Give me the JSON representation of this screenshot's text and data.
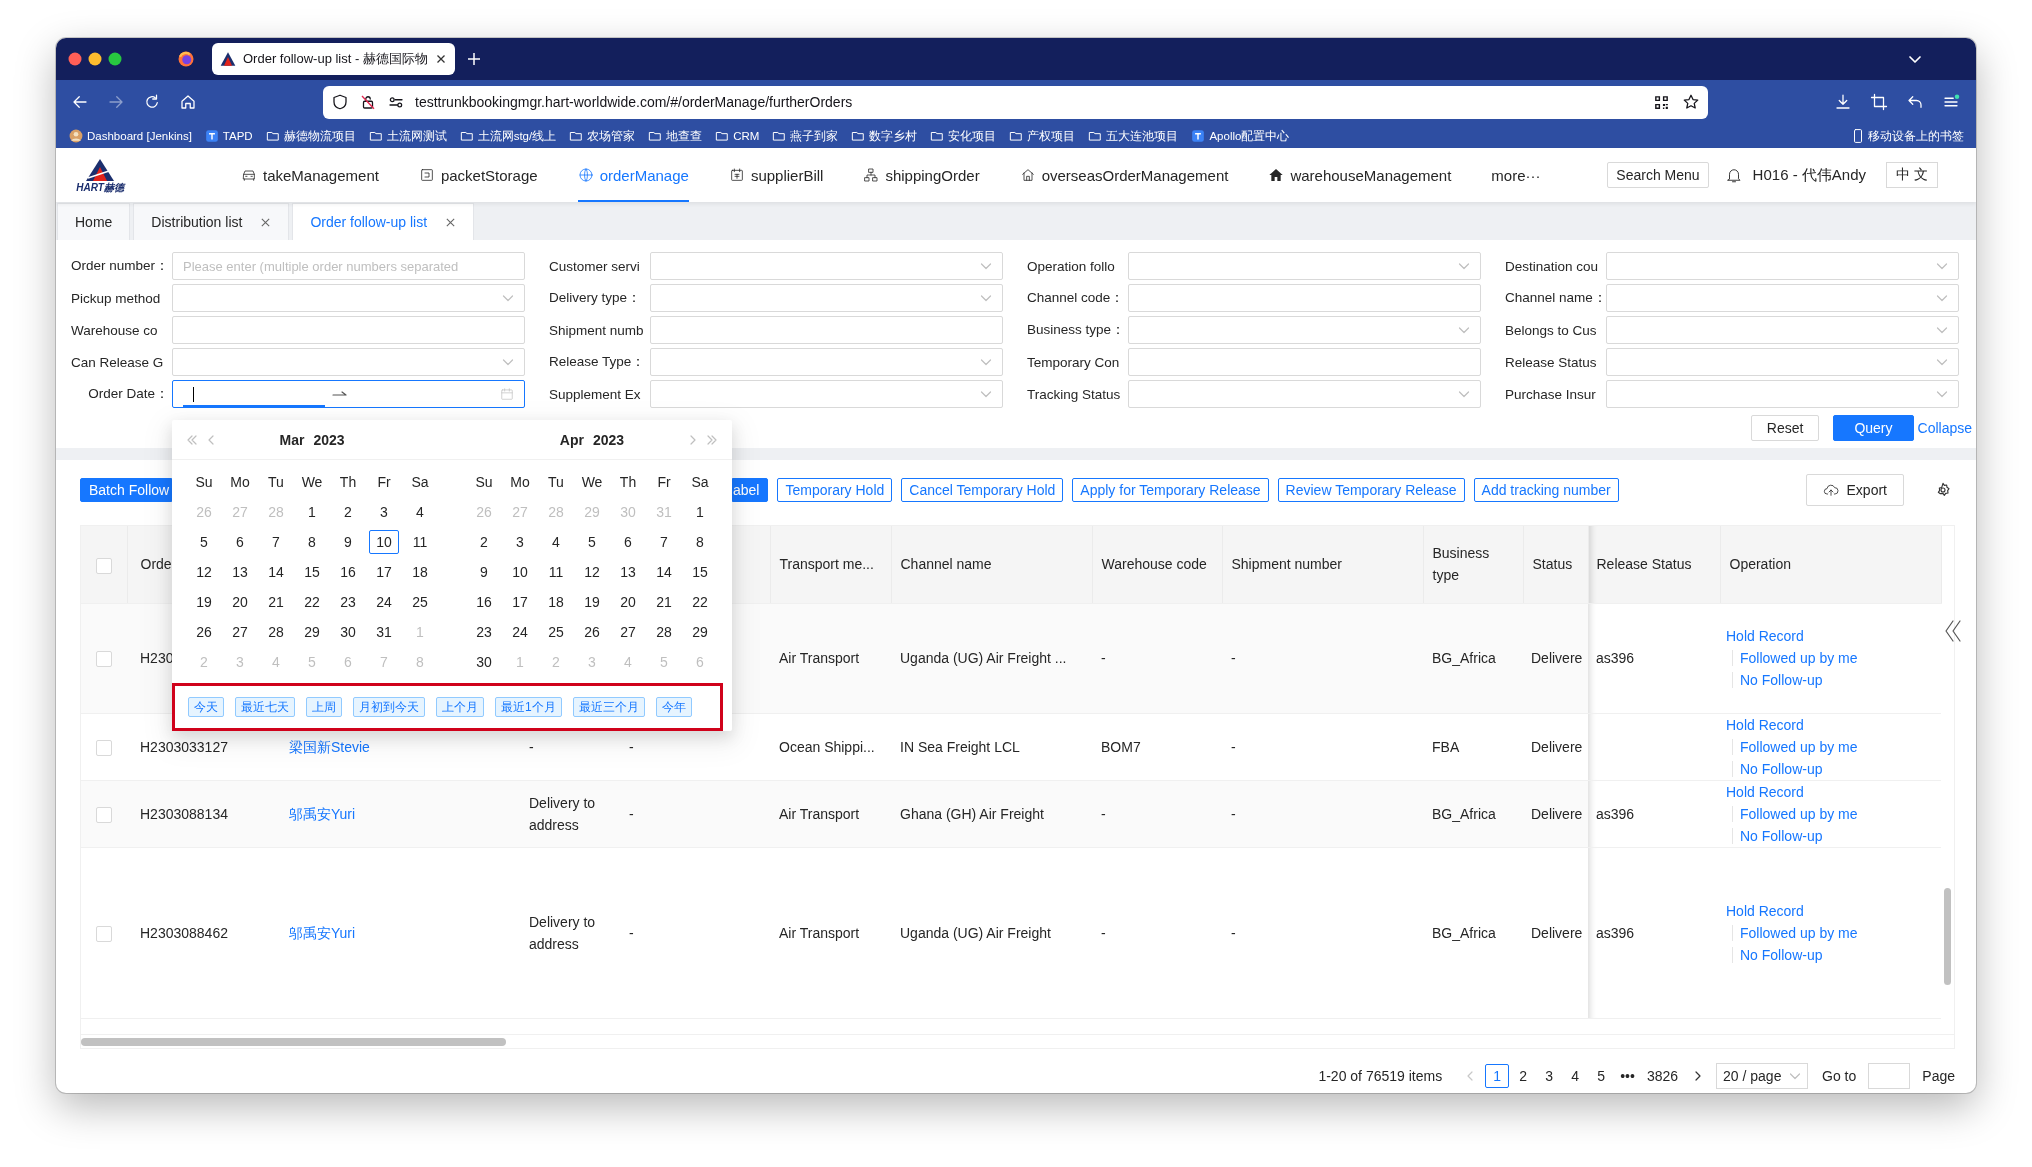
{
  "browser": {
    "tabs": [
      {
        "title": "Order follow-up list - 赫德国际物",
        "selected": true
      }
    ],
    "url": "testtrunkbookingmgr.hart-worldwide.com/#/orderManage/furtherOrders",
    "bookmarks": [
      {
        "label": "Dashboard [Jenkins]",
        "kind": "avatar"
      },
      {
        "label": "TAPD",
        "kind": "site"
      },
      {
        "label": "赫德物流项目",
        "kind": "folder"
      },
      {
        "label": "土流网测试",
        "kind": "folder"
      },
      {
        "label": "土流网stg/线上",
        "kind": "folder"
      },
      {
        "label": "农场管家",
        "kind": "folder"
      },
      {
        "label": "地查查",
        "kind": "folder"
      },
      {
        "label": "CRM",
        "kind": "folder"
      },
      {
        "label": "燕子到家",
        "kind": "folder"
      },
      {
        "label": "数字乡村",
        "kind": "folder"
      },
      {
        "label": "安化项目",
        "kind": "folder"
      },
      {
        "label": "产权项目",
        "kind": "folder"
      },
      {
        "label": "五大连池项目",
        "kind": "folder"
      },
      {
        "label": "Apollo配置中心",
        "kind": "site"
      }
    ],
    "mobile_bookmarks": "移动设备上的书签"
  },
  "app": {
    "logo_text": "HART赫德",
    "nav": [
      {
        "label": "takeManagement",
        "selected": false
      },
      {
        "label": "packetStorage",
        "selected": false
      },
      {
        "label": "orderManage",
        "selected": true
      },
      {
        "label": "supplierBill",
        "selected": false
      },
      {
        "label": "shippingOrder",
        "selected": false
      },
      {
        "label": "overseasOrderManagement",
        "selected": false
      },
      {
        "label": "warehouseManagement",
        "selected": false
      }
    ],
    "more": "more···",
    "search_button": "Search Menu",
    "user": "H016 - 代伟Andy",
    "language": "中 文"
  },
  "page_tabs": [
    {
      "label": "Home",
      "selected": false,
      "closable": false
    },
    {
      "label": "Distribution list",
      "selected": false,
      "closable": true
    },
    {
      "label": "Order follow-up list",
      "selected": true,
      "closable": true
    }
  ],
  "filters": [
    {
      "label": "Order number：",
      "kind": "text",
      "placeholder": "Please enter (multiple order numbers separated",
      "focused": false
    },
    {
      "label": "Customer servi",
      "kind": "select",
      "focused": false
    },
    {
      "label": "Operation follo",
      "kind": "select",
      "focused": false
    },
    {
      "label": "Destination cou",
      "kind": "select",
      "focused": false
    },
    {
      "label": "Pickup method",
      "kind": "select",
      "focused": false
    },
    {
      "label": "Delivery type：",
      "kind": "select",
      "focused": false
    },
    {
      "label": "Channel code：",
      "kind": "text",
      "focused": false
    },
    {
      "label": "Channel name：",
      "kind": "select",
      "focused": false
    },
    {
      "label": "Warehouse co",
      "kind": "text",
      "focused": false
    },
    {
      "label": "Shipment numb",
      "kind": "text",
      "focused": false
    },
    {
      "label": "Business type：",
      "kind": "select",
      "focused": false
    },
    {
      "label": "Belongs to Cus",
      "kind": "select",
      "focused": false
    },
    {
      "label": "Can Release G",
      "kind": "select",
      "focused": false
    },
    {
      "label": "Release Type：",
      "kind": "select",
      "focused": false
    },
    {
      "label": "Temporary Con",
      "kind": "text",
      "focused": false
    },
    {
      "label": "Release Status",
      "kind": "select",
      "focused": false
    },
    {
      "label": "Order Date：",
      "kind": "date_range",
      "focused": true
    },
    {
      "label": "Supplement Ex",
      "kind": "select",
      "focused": false
    },
    {
      "label": "Tracking Status",
      "kind": "select",
      "focused": false
    },
    {
      "label": "Purchase Insur",
      "kind": "select",
      "focused": false
    }
  ],
  "filter_actions": {
    "reset": "Reset",
    "query": "Query",
    "collapse": "Collapse"
  },
  "date_picker": {
    "months": [
      {
        "month": "Mar",
        "year": "2023",
        "weekdays": [
          "Su",
          "Mo",
          "Tu",
          "We",
          "Th",
          "Fr",
          "Sa"
        ],
        "weeks": [
          [
            {
              "day": "26",
              "in_month": false,
              "today": false
            },
            {
              "day": "27",
              "in_month": false,
              "today": false
            },
            {
              "day": "28",
              "in_month": false,
              "today": false
            },
            {
              "day": "1",
              "in_month": true,
              "today": false
            },
            {
              "day": "2",
              "in_month": true,
              "today": false
            },
            {
              "day": "3",
              "in_month": true,
              "today": false
            },
            {
              "day": "4",
              "in_month": true,
              "today": false
            }
          ],
          [
            {
              "day": "5",
              "in_month": true,
              "today": false
            },
            {
              "day": "6",
              "in_month": true,
              "today": false
            },
            {
              "day": "7",
              "in_month": true,
              "today": false
            },
            {
              "day": "8",
              "in_month": true,
              "today": false
            },
            {
              "day": "9",
              "in_month": true,
              "today": false
            },
            {
              "day": "10",
              "in_month": true,
              "today": true
            },
            {
              "day": "11",
              "in_month": true,
              "today": false
            }
          ],
          [
            {
              "day": "12",
              "in_month": true,
              "today": false
            },
            {
              "day": "13",
              "in_month": true,
              "today": false
            },
            {
              "day": "14",
              "in_month": true,
              "today": false
            },
            {
              "day": "15",
              "in_month": true,
              "today": false
            },
            {
              "day": "16",
              "in_month": true,
              "today": false
            },
            {
              "day": "17",
              "in_month": true,
              "today": false
            },
            {
              "day": "18",
              "in_month": true,
              "today": false
            }
          ],
          [
            {
              "day": "19",
              "in_month": true,
              "today": false
            },
            {
              "day": "20",
              "in_month": true,
              "today": false
            },
            {
              "day": "21",
              "in_month": true,
              "today": false
            },
            {
              "day": "22",
              "in_month": true,
              "today": false
            },
            {
              "day": "23",
              "in_month": true,
              "today": false
            },
            {
              "day": "24",
              "in_month": true,
              "today": false
            },
            {
              "day": "25",
              "in_month": true,
              "today": false
            }
          ],
          [
            {
              "day": "26",
              "in_month": true,
              "today": false
            },
            {
              "day": "27",
              "in_month": true,
              "today": false
            },
            {
              "day": "28",
              "in_month": true,
              "today": false
            },
            {
              "day": "29",
              "in_month": true,
              "today": false
            },
            {
              "day": "30",
              "in_month": true,
              "today": false
            },
            {
              "day": "31",
              "in_month": true,
              "today": false
            },
            {
              "day": "1",
              "in_month": false,
              "today": false
            }
          ],
          [
            {
              "day": "2",
              "in_month": false,
              "today": false
            },
            {
              "day": "3",
              "in_month": false,
              "today": false
            },
            {
              "day": "4",
              "in_month": false,
              "today": false
            },
            {
              "day": "5",
              "in_month": false,
              "today": false
            },
            {
              "day": "6",
              "in_month": false,
              "today": false
            },
            {
              "day": "7",
              "in_month": false,
              "today": false
            },
            {
              "day": "8",
              "in_month": false,
              "today": false
            }
          ]
        ]
      },
      {
        "month": "Apr",
        "year": "2023",
        "weekdays": [
          "Su",
          "Mo",
          "Tu",
          "We",
          "Th",
          "Fr",
          "Sa"
        ],
        "weeks": [
          [
            {
              "day": "26",
              "in_month": false,
              "today": false
            },
            {
              "day": "27",
              "in_month": false,
              "today": false
            },
            {
              "day": "28",
              "in_month": false,
              "today": false
            },
            {
              "day": "29",
              "in_month": false,
              "today": false
            },
            {
              "day": "30",
              "in_month": false,
              "today": false
            },
            {
              "day": "31",
              "in_month": false,
              "today": false
            },
            {
              "day": "1",
              "in_month": true,
              "today": false
            }
          ],
          [
            {
              "day": "2",
              "in_month": true,
              "today": false
            },
            {
              "day": "3",
              "in_month": true,
              "today": false
            },
            {
              "day": "4",
              "in_month": true,
              "today": false
            },
            {
              "day": "5",
              "in_month": true,
              "today": false
            },
            {
              "day": "6",
              "in_month": true,
              "today": false
            },
            {
              "day": "7",
              "in_month": true,
              "today": false
            },
            {
              "day": "8",
              "in_month": true,
              "today": false
            }
          ],
          [
            {
              "day": "9",
              "in_month": true,
              "today": false
            },
            {
              "day": "10",
              "in_month": true,
              "today": false
            },
            {
              "day": "11",
              "in_month": true,
              "today": false
            },
            {
              "day": "12",
              "in_month": true,
              "today": false
            },
            {
              "day": "13",
              "in_month": true,
              "today": false
            },
            {
              "day": "14",
              "in_month": true,
              "today": false
            },
            {
              "day": "15",
              "in_month": true,
              "today": false
            }
          ],
          [
            {
              "day": "16",
              "in_month": true,
              "today": false
            },
            {
              "day": "17",
              "in_month": true,
              "today": false
            },
            {
              "day": "18",
              "in_month": true,
              "today": false
            },
            {
              "day": "19",
              "in_month": true,
              "today": false
            },
            {
              "day": "20",
              "in_month": true,
              "today": false
            },
            {
              "day": "21",
              "in_month": true,
              "today": false
            },
            {
              "day": "22",
              "in_month": true,
              "today": false
            }
          ],
          [
            {
              "day": "23",
              "in_month": true,
              "today": false
            },
            {
              "day": "24",
              "in_month": true,
              "today": false
            },
            {
              "day": "25",
              "in_month": true,
              "today": false
            },
            {
              "day": "26",
              "in_month": true,
              "today": false
            },
            {
              "day": "27",
              "in_month": true,
              "today": false
            },
            {
              "day": "28",
              "in_month": true,
              "today": false
            },
            {
              "day": "29",
              "in_month": true,
              "today": false
            }
          ],
          [
            {
              "day": "30",
              "in_month": true,
              "today": false
            },
            {
              "day": "1",
              "in_month": false,
              "today": false
            },
            {
              "day": "2",
              "in_month": false,
              "today": false
            },
            {
              "day": "3",
              "in_month": false,
              "today": false
            },
            {
              "day": "4",
              "in_month": false,
              "today": false
            },
            {
              "day": "5",
              "in_month": false,
              "today": false
            },
            {
              "day": "6",
              "in_month": false,
              "today": false
            }
          ]
        ]
      }
    ],
    "presets": [
      "今天",
      "最近七天",
      "上周",
      "月初到今天",
      "上个月",
      "最近1个月",
      "最近三个月",
      "今年"
    ],
    "highlighted": true
  },
  "toolbar": {
    "buttons": [
      {
        "label": "Batch Follow",
        "kind": "primary"
      },
      {
        "label": "abel",
        "kind": "primary"
      },
      {
        "label": "Temporary Hold",
        "kind": "outline"
      },
      {
        "label": "Cancel Temporary Hold",
        "kind": "outline"
      },
      {
        "label": "Apply for Temporary Release",
        "kind": "outline"
      },
      {
        "label": "Review Temporary Release",
        "kind": "outline"
      },
      {
        "label": "Add tracking number",
        "kind": "outline"
      }
    ],
    "export": "Export"
  },
  "table": {
    "all_checked": false,
    "columns": [
      {
        "label": "Orde",
        "kind": "text"
      },
      {
        "kind": "link"
      },
      {
        "kind": "text"
      },
      {
        "kind": "text"
      },
      {
        "label": "Transport me...",
        "kind": "text"
      },
      {
        "label": "Channel name",
        "kind": "text"
      },
      {
        "label": "Warehouse code",
        "kind": "text"
      },
      {
        "label": "Shipment number",
        "kind": "text"
      },
      {
        "label": "Business type",
        "kind": "text"
      },
      {
        "label": "Status",
        "kind": "text"
      },
      {
        "label": "Release Status",
        "kind": "text"
      },
      {
        "label": "Operation",
        "kind": "actions"
      }
    ],
    "rows": [
      {
        "checked": false,
        "cells": [
          "H230",
          null,
          null,
          null,
          "Air Transport",
          "Uganda (UG) Air Freight ...",
          "-",
          "-",
          "BG_Africa",
          "Delivere",
          "as396"
        ],
        "operations": [
          "Hold Record",
          "Followed up by me",
          "No Follow-up"
        ]
      },
      {
        "checked": false,
        "cells": [
          "H2303033127",
          "梁国新Stevie",
          "-",
          "-",
          "Ocean Shippi...",
          "IN Sea Freight LCL",
          "BOM7",
          "-",
          "FBA",
          "Delivere",
          null
        ],
        "operations": [
          "Hold Record",
          "Followed up by me",
          "No Follow-up"
        ]
      },
      {
        "checked": false,
        "cells": [
          "H2303088134",
          "邬禹安Yuri",
          "Delivery to address",
          "-",
          "Air Transport",
          "Ghana (GH) Air Freight",
          "-",
          "-",
          "BG_Africa",
          "Delivere",
          "as396"
        ],
        "operations": [
          "Hold Record",
          "Followed up by me",
          "No Follow-up"
        ]
      },
      {
        "checked": false,
        "cells": [
          "H2303088462",
          "邬禹安Yuri",
          "Delivery to address",
          "-",
          "Air Transport",
          "Uganda (UG) Air Freight",
          "-",
          "-",
          "BG_Africa",
          "Delivere",
          "as396"
        ],
        "operations": [
          "Hold Record",
          "Followed up by me",
          "No Follow-up"
        ]
      }
    ]
  },
  "pagination": {
    "summary": "1-20 of 76519 items",
    "prev_disabled": true,
    "next_disabled": false,
    "pages": [
      {
        "label": "1",
        "selected": true
      },
      {
        "label": "2",
        "selected": false
      },
      {
        "label": "3",
        "selected": false
      },
      {
        "label": "4",
        "selected": false
      },
      {
        "label": "5",
        "selected": false
      },
      {
        "label": "•••",
        "selected": false
      },
      {
        "label": "3826",
        "selected": false
      }
    ],
    "page_size": "20 / page",
    "goto_label": "Go to",
    "page_label": "Page"
  }
}
